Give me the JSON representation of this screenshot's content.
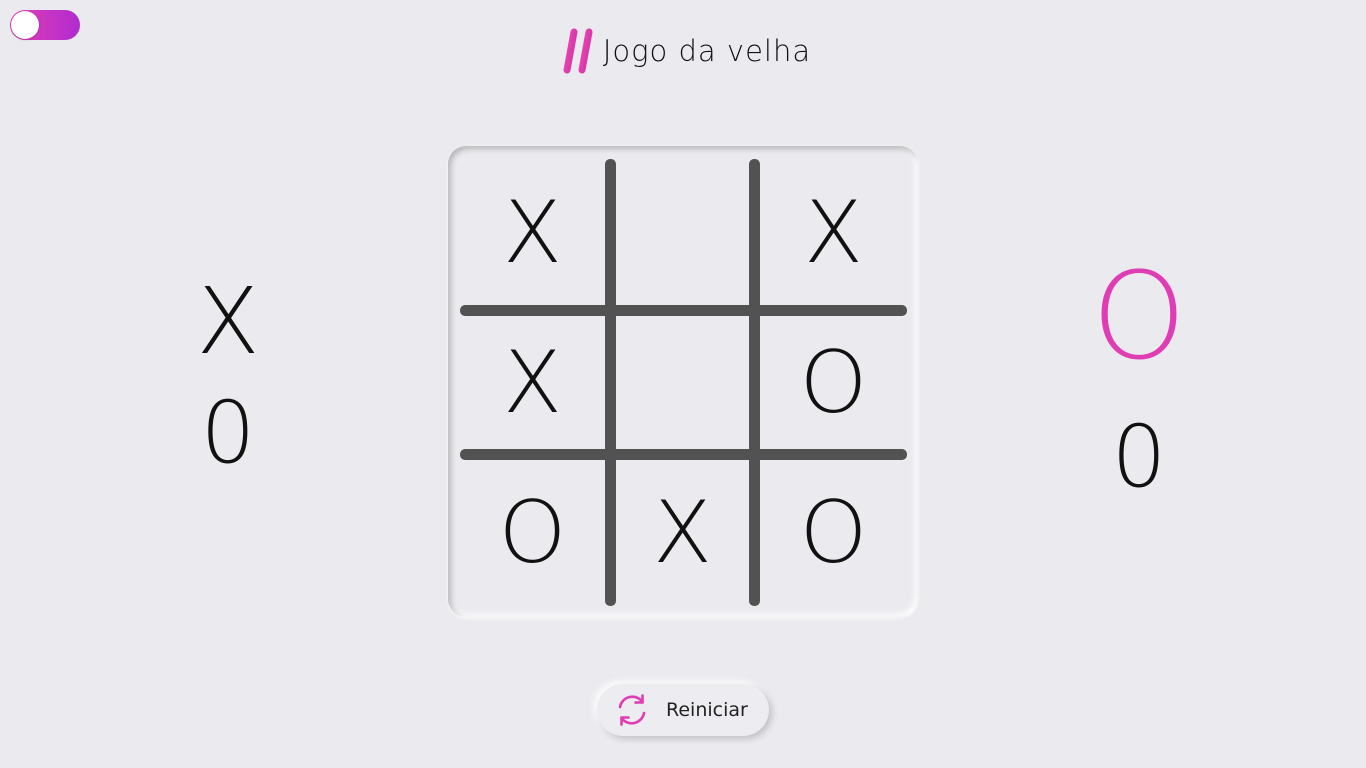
{
  "header": {
    "title": "Jogo da velha",
    "icon": "hash-icon"
  },
  "theme_toggle": {
    "state": "on",
    "accent": "#de3db4"
  },
  "players": {
    "x": {
      "mark": "X",
      "score": "0",
      "active": false
    },
    "o": {
      "mark": "O",
      "score": "0",
      "active": true,
      "color": "#de3db4"
    }
  },
  "board": {
    "cells": [
      "X",
      "",
      "X",
      "X",
      "",
      "O",
      "O",
      "X",
      "O"
    ]
  },
  "restart": {
    "label": "Reiniciar",
    "icon": "refresh-icon"
  },
  "colors": {
    "background": "#ebebef",
    "accent": "#de3db4",
    "grid": "#525252",
    "text": "#111111"
  }
}
